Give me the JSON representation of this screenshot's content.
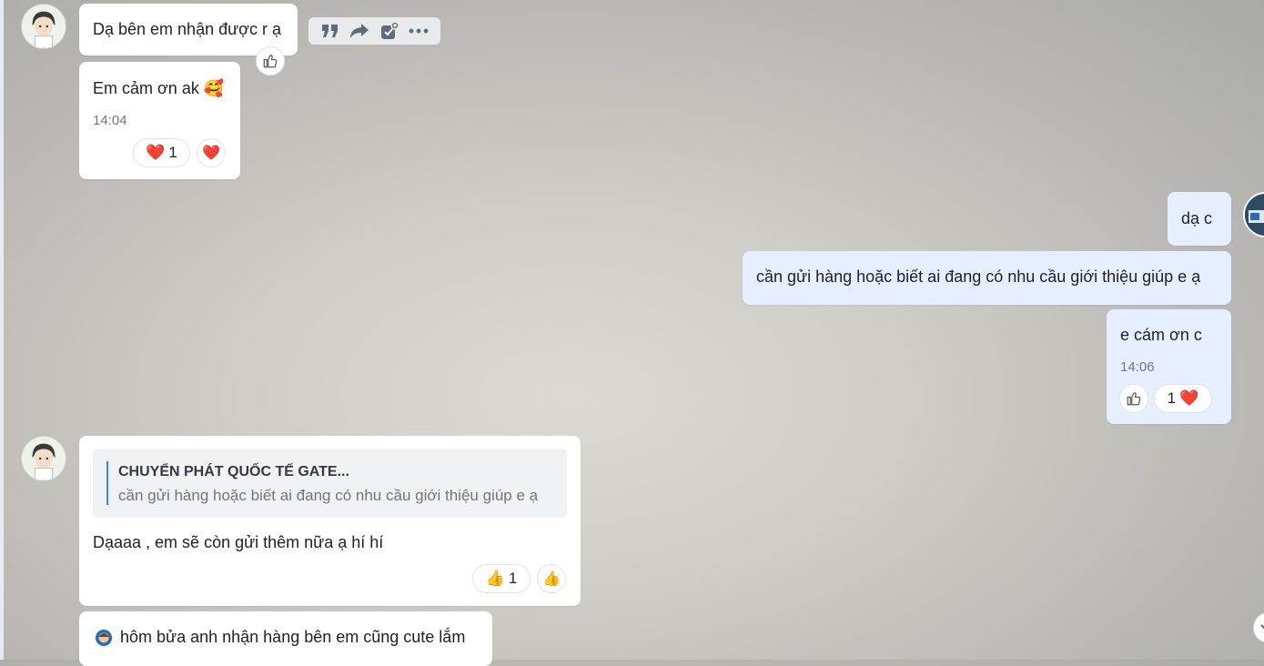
{
  "messages": {
    "m1": {
      "text": "Dạ bên em nhận được r ạ"
    },
    "m2": {
      "text": "Em cảm ơn ak",
      "emoji": "🥰",
      "time": "14:04",
      "reaction_count": "1"
    },
    "m3": {
      "text": "dạ  c"
    },
    "m4": {
      "text": "cần gửi hàng hoặc biết ai đang có nhu cầu giới thiệu giúp e ạ"
    },
    "m5": {
      "text": "e cám ơn c",
      "time": "14:06",
      "reaction_count": "1"
    },
    "m6": {
      "quote_title": "CHUYỂN PHÁT QUỐC TẾ GATE...",
      "quote_text": "cần gửi hàng hoặc biết ai đang có nhu cầu giới thiệu giúp e ạ",
      "text": "Dạaaa , em sẽ còn gửi thêm nữa ạ hí hí",
      "reaction_count": "1"
    },
    "m7": {
      "text": "hôm bửa anh nhận hàng bên em cũng cute lắm"
    }
  },
  "emoji": {
    "heart": "❤️",
    "thumbs_up": "👍"
  },
  "icons": {
    "toolbar": [
      "quote-icon",
      "forward-icon",
      "add-task-icon",
      "more-icon"
    ],
    "like": "thumbs-up-outline-icon"
  },
  "colors": {
    "bubble_me": "#e5efff",
    "bubble_other": "#ffffff",
    "quote_bar": "#3a82f7",
    "heart": "#e0243a"
  }
}
